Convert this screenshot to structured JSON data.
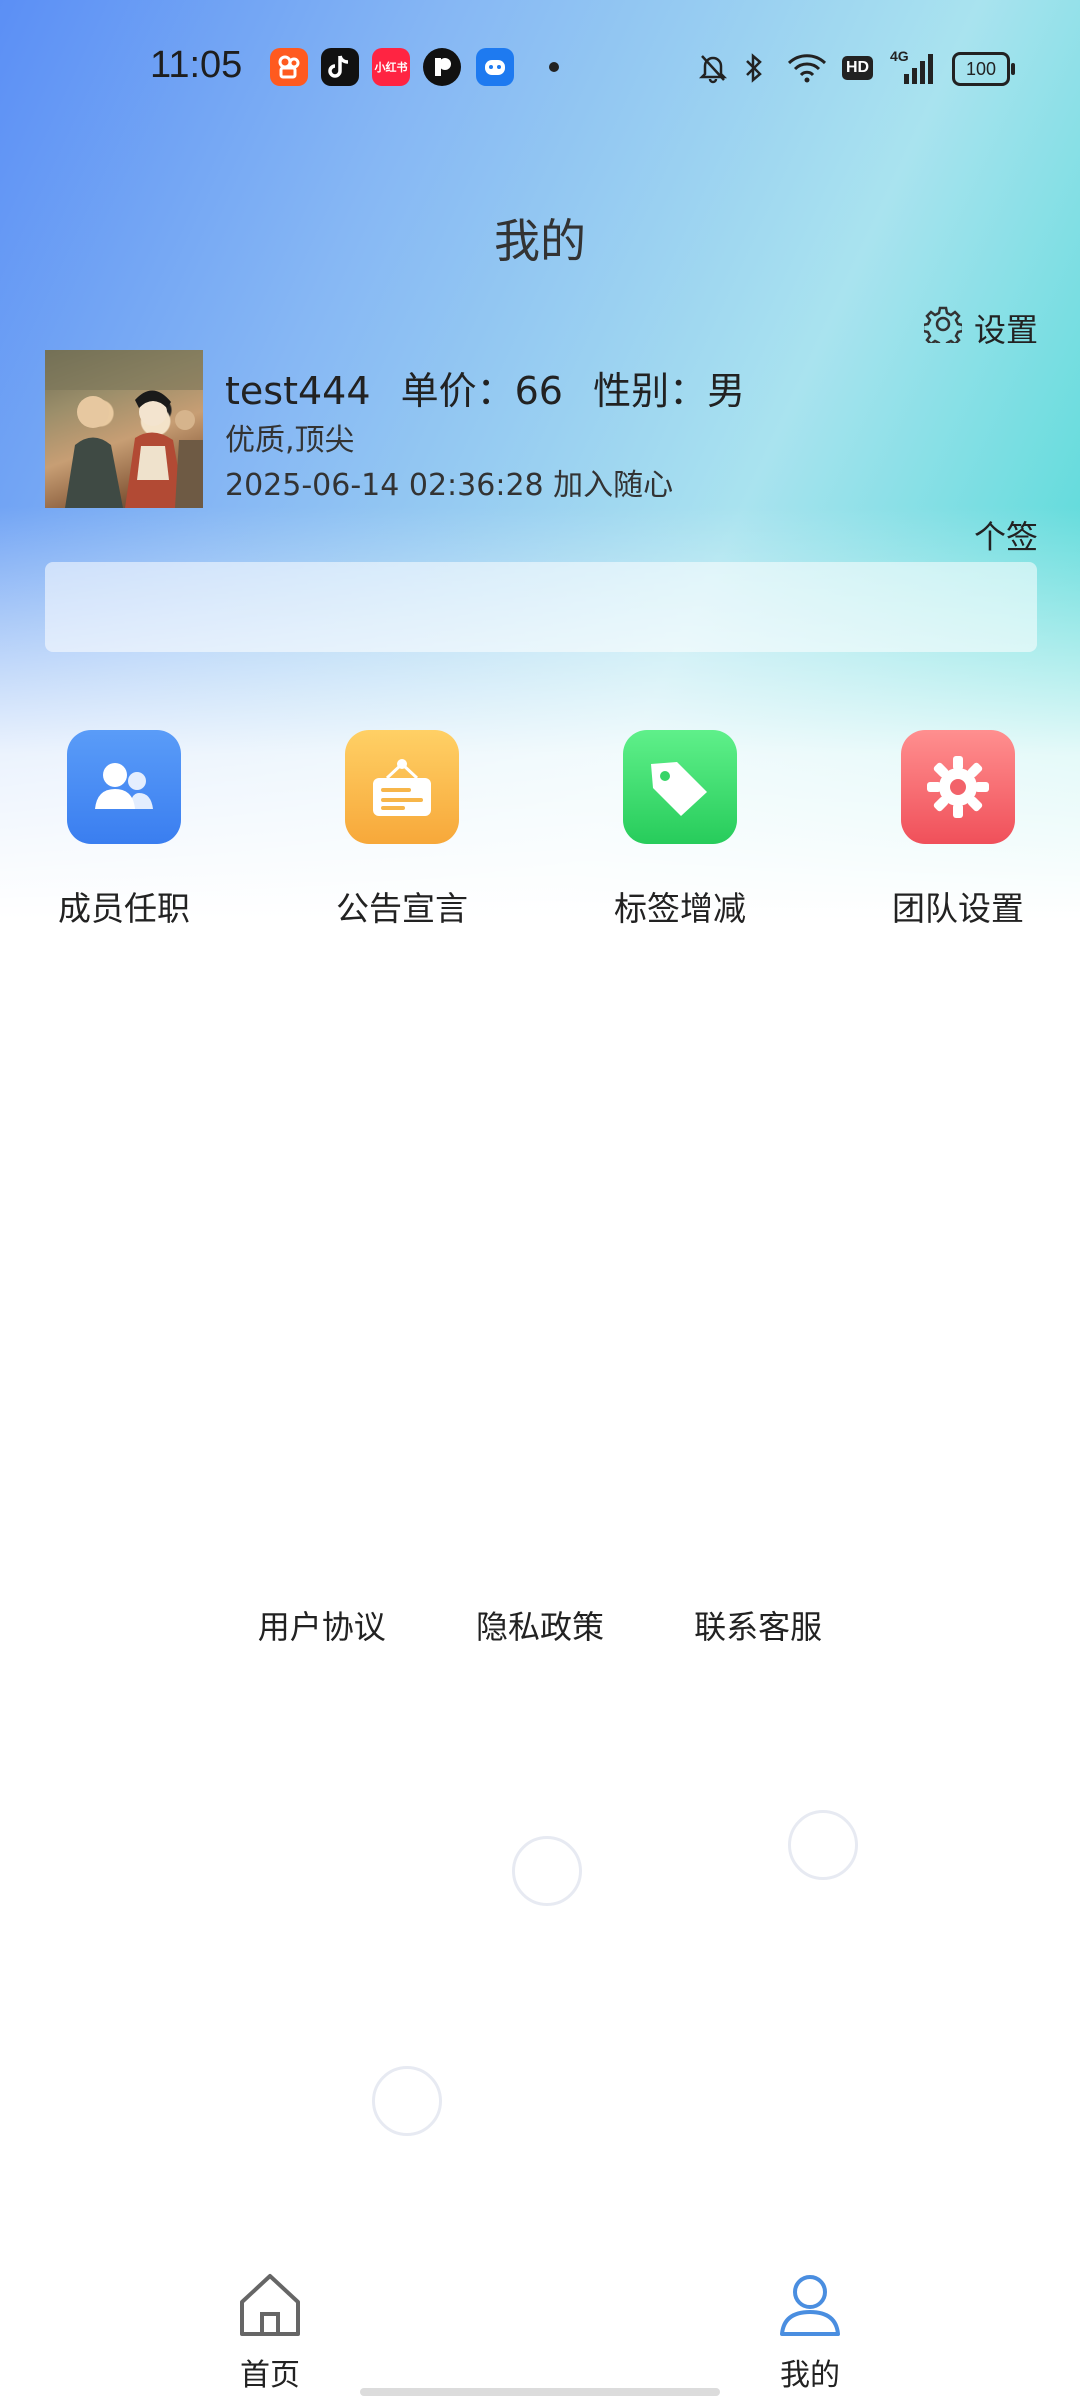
{
  "status_bar": {
    "time": "11:05",
    "apps": [
      {
        "icon": "kuaishou-icon",
        "color": "#ff5a1f",
        "text": ""
      },
      {
        "icon": "tiktok-icon",
        "color": "#111111",
        "text": ""
      },
      {
        "icon": "xiaohongshu-icon",
        "color": "#ff2442",
        "text": "小红书"
      },
      {
        "icon": "app-p-icon",
        "color": "#111111",
        "text": ""
      },
      {
        "icon": "robot-app-icon",
        "color": "#1e7af0",
        "text": ""
      }
    ],
    "hd": "HD",
    "network": "4G",
    "battery": "100"
  },
  "page": {
    "title": "我的"
  },
  "profile": {
    "settings_label": "设置",
    "username": "test444",
    "price": "单价：66",
    "gender": "性别：男",
    "tags": "优质,顶尖",
    "joined": "2025-06-14 02:36:28 加入随心",
    "signature_label": "个签",
    "signature": ""
  },
  "menu": [
    {
      "label": "成员任职",
      "icon": "members-icon",
      "color_from": "#5a9cf8",
      "color_to": "#3a7ef0"
    },
    {
      "label": "公告宣言",
      "icon": "notice-board-icon",
      "color_from": "#ffd065",
      "color_to": "#f7a83a"
    },
    {
      "label": "标签增减",
      "icon": "tag-icon",
      "color_from": "#5ff08a",
      "color_to": "#27cc5b"
    },
    {
      "label": "团队设置",
      "icon": "team-settings-icon",
      "color_from": "#ff8f8f",
      "color_to": "#f0505a"
    }
  ],
  "footer_links": [
    "用户协议",
    "隐私政策",
    "联系客服"
  ],
  "tabbar": {
    "home": "首页",
    "mine": "我的",
    "active_color": "#4a8ee0"
  }
}
